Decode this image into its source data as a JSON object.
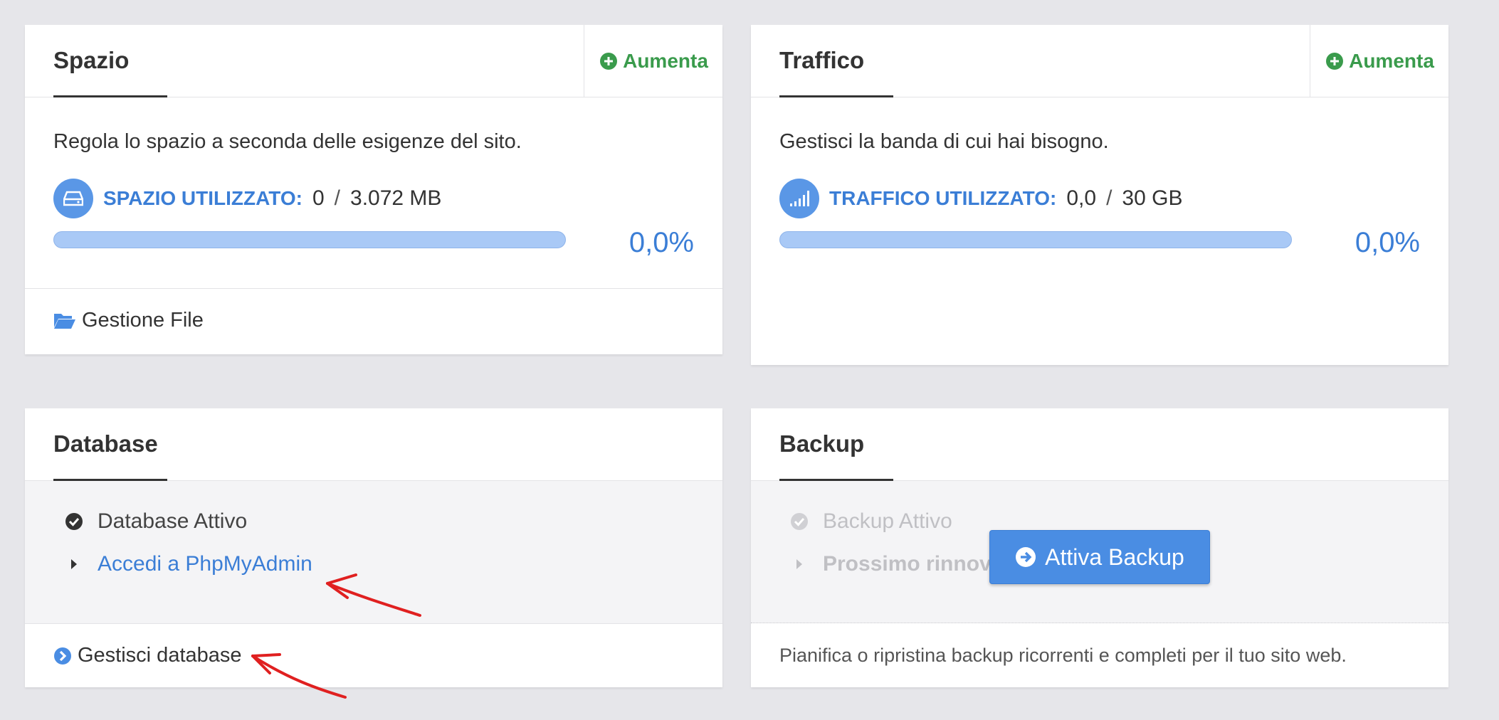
{
  "space": {
    "title": "Spazio",
    "increase_label": "Aumenta",
    "description": "Regola lo spazio a seconda delle esigenze del sito.",
    "usage_label": "SPAZIO UTILIZZATO:",
    "used": "0",
    "separator": "/",
    "total": "3.072 MB",
    "percent": "0,0%",
    "progress": 0,
    "footer_link": "Gestione File"
  },
  "traffic": {
    "title": "Traffico",
    "increase_label": "Aumenta",
    "description": "Gestisci la banda di cui hai bisogno.",
    "usage_label": "TRAFFICO UTILIZZATO:",
    "used": "0,0",
    "separator": "/",
    "total": "30 GB",
    "percent": "0,0%",
    "progress": 0
  },
  "database": {
    "title": "Database",
    "status": "Database Attivo",
    "phpmyadmin_link": "Accedi a PhpMyAdmin",
    "footer_link": "Gestisci database"
  },
  "backup": {
    "title": "Backup",
    "status": "Backup Attivo",
    "next_renewal": "Prossimo rinnovo",
    "activate_button": "Attiva Backup",
    "description": "Pianifica o ripristina backup ricorrenti e completi per il tuo sito web."
  },
  "colors": {
    "accent_blue": "#3b7ed6",
    "accent_green": "#3a9b4c",
    "annotation_red": "#e02020"
  }
}
